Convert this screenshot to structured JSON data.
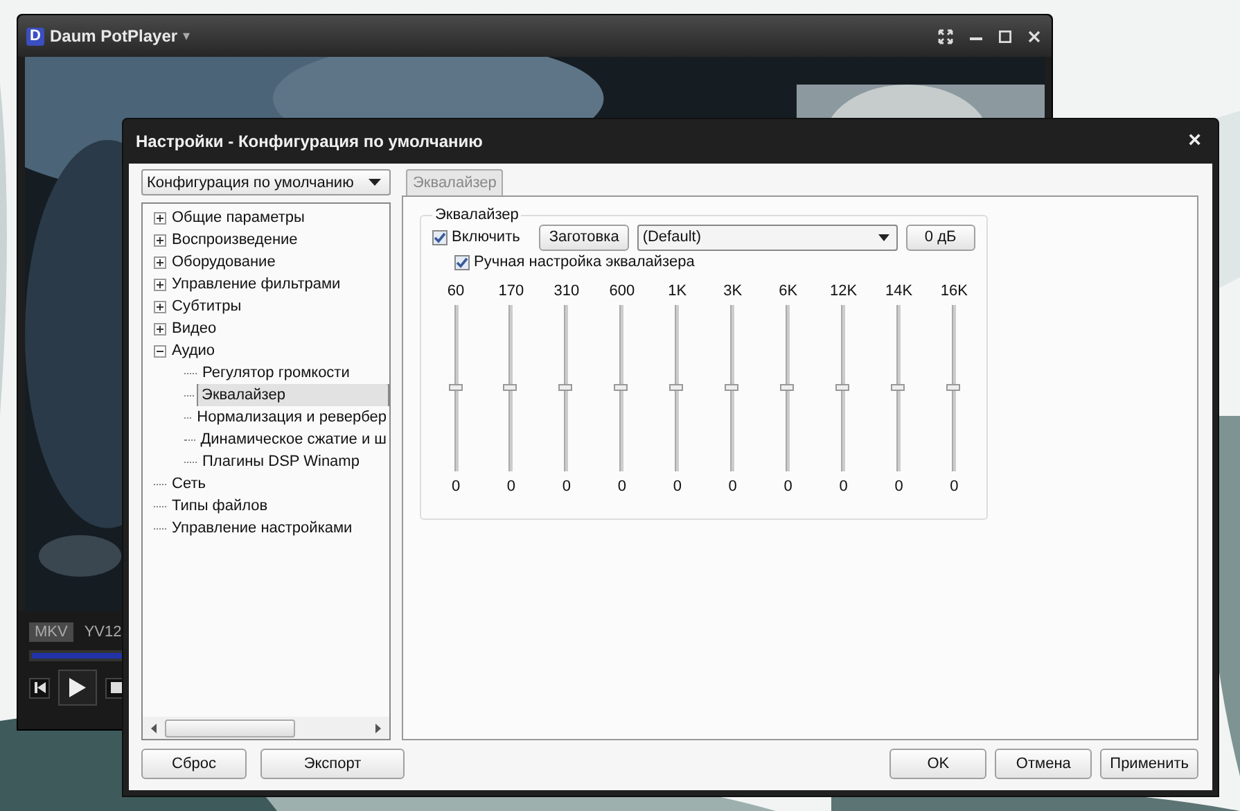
{
  "player": {
    "logo_letter": "D",
    "title": "Daum PotPlayer",
    "caret": "▾",
    "format_tags": [
      "MKV",
      "YV12"
    ]
  },
  "dialog": {
    "title": "Настройки - Конфигурация по умолчанию",
    "close": "×",
    "config_select": {
      "value": "Конфигурация по умолчанию"
    },
    "tree": [
      {
        "kind": "group",
        "label": "Общие параметры",
        "expanded": false,
        "selected": false
      },
      {
        "kind": "group",
        "label": "Воспроизведение",
        "expanded": false,
        "selected": false
      },
      {
        "kind": "group",
        "label": "Оборудование",
        "expanded": false,
        "selected": false
      },
      {
        "kind": "group",
        "label": "Управление фильтрами",
        "expanded": false,
        "selected": false
      },
      {
        "kind": "group",
        "label": "Субтитры",
        "expanded": false,
        "selected": false
      },
      {
        "kind": "group",
        "label": "Видео",
        "expanded": false,
        "selected": false
      },
      {
        "kind": "group",
        "label": "Аудио",
        "expanded": true,
        "selected": false,
        "children": [
          {
            "label": "Регулятор громкости",
            "selected": false
          },
          {
            "label": "Эквалайзер",
            "selected": true
          },
          {
            "label": "Нормализация и ревербер",
            "selected": false
          },
          {
            "label": "Динамическое сжатие и ш",
            "selected": false
          },
          {
            "label": "Плагины DSP Winamp",
            "selected": false
          }
        ]
      },
      {
        "kind": "leaf",
        "label": "Сеть",
        "selected": false
      },
      {
        "kind": "leaf",
        "label": "Типы файлов",
        "selected": false
      },
      {
        "kind": "leaf",
        "label": "Управление настройками",
        "selected": false
      }
    ],
    "tabs": [
      {
        "label": "Эквалайзер",
        "selected": true
      }
    ],
    "equalizer": {
      "group_title": "Эквалайзер",
      "enable": {
        "label": "Включить",
        "checked": true
      },
      "preset_button": "Заготовка",
      "preset_select": {
        "value": "(Default)"
      },
      "gain_button": "0 дБ",
      "manual": {
        "label": "Ручная настройка эквалайзера",
        "checked": true
      },
      "bands": [
        {
          "label": "60",
          "level": 0.5,
          "reading": "0"
        },
        {
          "label": "170",
          "level": 0.5,
          "reading": "0"
        },
        {
          "label": "310",
          "level": 0.5,
          "reading": "0"
        },
        {
          "label": "600",
          "level": 0.5,
          "reading": "0"
        },
        {
          "label": "1K",
          "level": 0.5,
          "reading": "0"
        },
        {
          "label": "3K",
          "level": 0.5,
          "reading": "0"
        },
        {
          "label": "6K",
          "level": 0.5,
          "reading": "0"
        },
        {
          "label": "12K",
          "level": 0.5,
          "reading": "0"
        },
        {
          "label": "14K",
          "level": 0.5,
          "reading": "0"
        },
        {
          "label": "16K",
          "level": 0.5,
          "reading": "0"
        }
      ]
    },
    "left_buttons": [
      {
        "label": "Сброс"
      },
      {
        "label": "Экспорт"
      }
    ],
    "right_buttons": [
      {
        "label": "OK"
      },
      {
        "label": "Отмена"
      },
      {
        "label": "Применить"
      }
    ]
  }
}
